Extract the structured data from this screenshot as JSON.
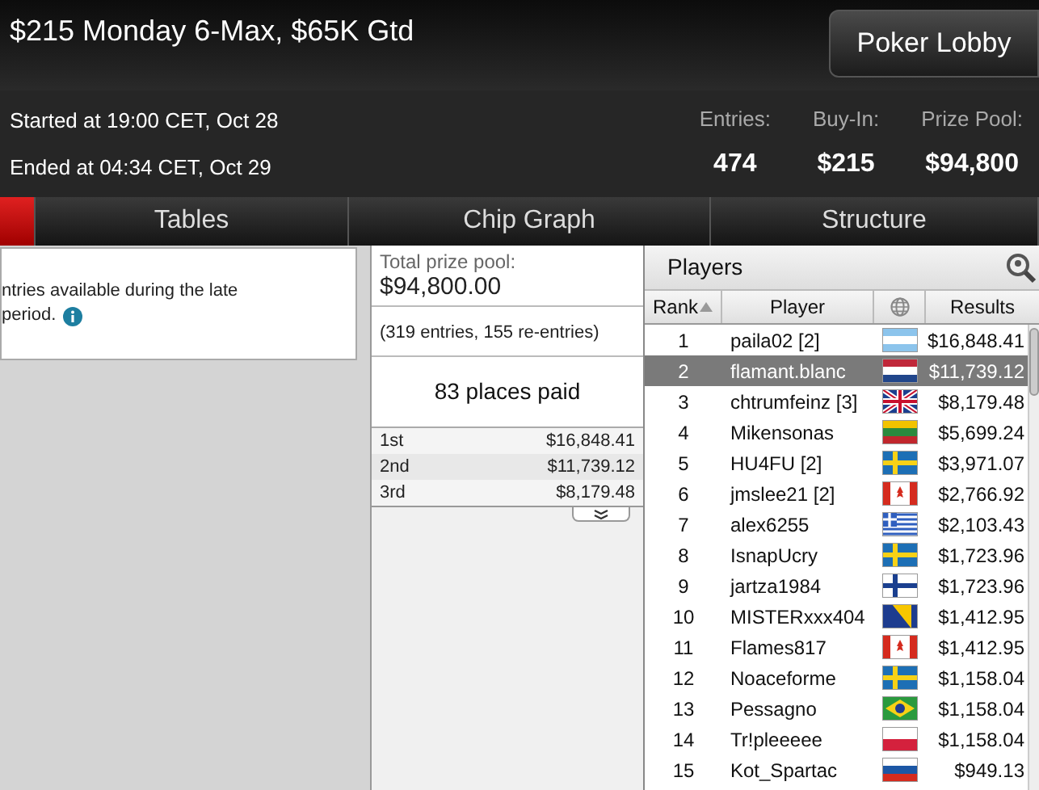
{
  "title": "$215 Monday 6-Max, $65K Gtd",
  "lobby_button": "Poker Lobby",
  "started": "Started at 19:00 CET, Oct 28",
  "ended": "Ended at 04:34 CET, Oct 29",
  "stats": [
    {
      "label": "Entries:",
      "value": "474"
    },
    {
      "label": "Buy-In:",
      "value": "$215"
    },
    {
      "label": "Prize Pool:",
      "value": "$94,800"
    }
  ],
  "tabs": [
    {
      "selected": true
    },
    {
      "label": "Tables",
      "selected": false
    },
    {
      "label": "Chip Graph",
      "selected": false
    },
    {
      "label": "Structure",
      "selected": false
    }
  ],
  "notice": [
    "ntries available during the late",
    "period."
  ],
  "prize": {
    "total_label": "Total prize pool:",
    "total": "$94,800.00",
    "entries": "(319 entries, 155 re-entries)",
    "places_paid": "83 places paid",
    "payouts": [
      {
        "place": "1st",
        "amount": "$16,848.41"
      },
      {
        "place": "2nd",
        "amount": "$11,739.12"
      },
      {
        "place": "3rd",
        "amount": "$8,179.48"
      }
    ]
  },
  "players": {
    "title": "Players",
    "columns": [
      "Rank",
      "Player",
      "Results"
    ],
    "rows": [
      {
        "rank": "1",
        "player": "paila02 [2]",
        "kind": "ar",
        "result": "$16,848.41",
        "selected": false
      },
      {
        "rank": "2",
        "player": "flamant.blanc",
        "kind": "nl",
        "result": "$11,739.12",
        "selected": true
      },
      {
        "rank": "3",
        "player": "chtrumfeinz [3]",
        "kind": "gb",
        "result": "$8,179.48",
        "selected": false
      },
      {
        "rank": "4",
        "player": "Mikensonas",
        "kind": "lt",
        "result": "$5,699.24",
        "selected": false
      },
      {
        "rank": "5",
        "player": "HU4FU [2]",
        "kind": "se",
        "result": "$3,971.07",
        "selected": false
      },
      {
        "rank": "6",
        "player": "jmslee21 [2]",
        "kind": "ca",
        "result": "$2,766.92",
        "selected": false
      },
      {
        "rank": "7",
        "player": "alex6255",
        "kind": "gr",
        "result": "$2,103.43",
        "selected": false
      },
      {
        "rank": "8",
        "player": "IsnapUcry",
        "kind": "se",
        "result": "$1,723.96",
        "selected": false
      },
      {
        "rank": "9",
        "player": "jartza1984",
        "kind": "fi",
        "result": "$1,723.96",
        "selected": false
      },
      {
        "rank": "10",
        "player": "MISTERxxx404",
        "kind": "ba",
        "result": "$1,412.95",
        "selected": false
      },
      {
        "rank": "11",
        "player": "Flames817",
        "kind": "ca",
        "result": "$1,412.95",
        "selected": false
      },
      {
        "rank": "12",
        "player": "Noaceforme",
        "kind": "se",
        "result": "$1,158.04",
        "selected": false
      },
      {
        "rank": "13",
        "player": "Pessagno",
        "kind": "br",
        "result": "$1,158.04",
        "selected": false
      },
      {
        "rank": "14",
        "player": "Tr!pleeeee",
        "kind": "pl",
        "result": "$1,158.04",
        "selected": false
      },
      {
        "rank": "15",
        "player": "Kot_Spartac",
        "kind": "ru",
        "result": "$949.13",
        "selected": false
      }
    ]
  }
}
